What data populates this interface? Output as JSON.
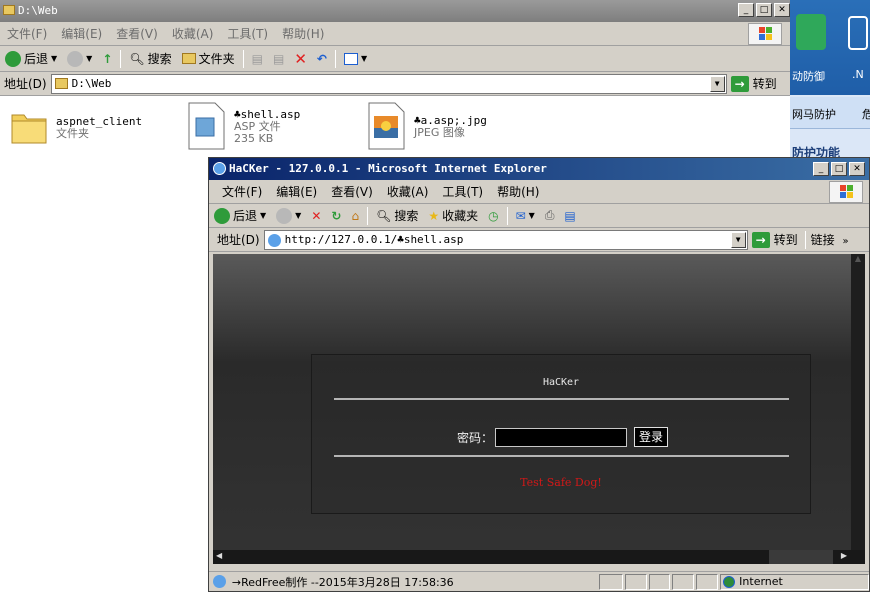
{
  "explorer": {
    "title": "D:\\Web",
    "menu": [
      "文件(F)",
      "编辑(E)",
      "查看(V)",
      "收藏(A)",
      "工具(T)",
      "帮助(H)"
    ],
    "toolbar": {
      "back": "后退",
      "search": "搜索",
      "folders": "文件夹"
    },
    "address_label": "地址(D)",
    "address_value": "D:\\Web",
    "go_label": "转到",
    "files": [
      {
        "name": "aspnet_client",
        "type": "文件夹",
        "size": ""
      },
      {
        "name": "♣shell.asp",
        "type": "ASP 文件",
        "size": "235 KB"
      },
      {
        "name": "♣a.asp;.jpg",
        "type": "JPEG 图像",
        "size": ""
      }
    ]
  },
  "side_window": {
    "label_top": "动防御",
    "label_n": ".N",
    "tab": "网马防护",
    "tab2": "危",
    "bottom": "防护功能"
  },
  "ie": {
    "title": "HaCKer - 127.0.0.1 - Microsoft Internet Explorer",
    "menu": [
      "文件(F)",
      "编辑(E)",
      "查看(V)",
      "收藏(A)",
      "工具(T)",
      "帮助(H)"
    ],
    "toolbar": {
      "back": "后退",
      "search": "搜索",
      "favorites": "收藏夹"
    },
    "address_label": "地址(D)",
    "address_value": "http://127.0.0.1/♣shell.asp",
    "go_label": "转到",
    "links_label": "链接",
    "page": {
      "heading": "HaCKer",
      "password_label": "密码：",
      "password_value": "",
      "login_button": "登录",
      "footer_text": "Test Safe Dog!",
      "footer_color": "#d01818"
    },
    "status": {
      "text": "→RedFree制作 --2015年3月28日 17:58:36",
      "zone": "Internet"
    }
  }
}
